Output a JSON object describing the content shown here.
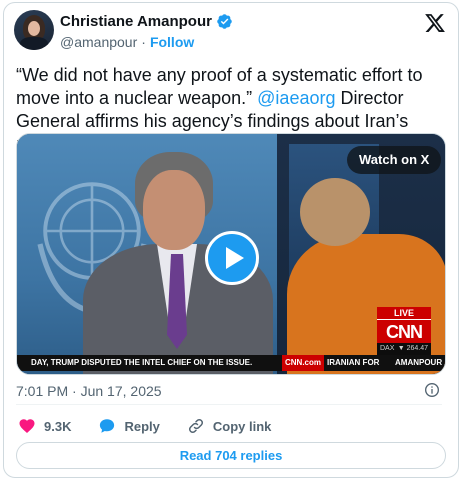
{
  "author": {
    "name": "Christiane Amanpour",
    "handle": "@amanpour",
    "separator": "·",
    "follow_label": "Follow",
    "verified_color": "#1d9bf0"
  },
  "tweet": {
    "text_before": "“We did not have any proof of a systematic effort to move into a nuclear weapon.”",
    "mention": "@iaeaorg",
    "text_after": "Director General affirms his agency’s findings about Iran’s nuclear program."
  },
  "media": {
    "watch_label": "Watch on X",
    "live_label": "LIVE",
    "network_logo": "CNN",
    "dax_label": "DAX",
    "dax_value": "▼ 264.47",
    "ticker_text": "DAY, TRUMP DISPUTED THE INTEL CHIEF ON THE ISSUE.",
    "ticker_site": "CNN.com",
    "ticker_text_2": "IRANIAN FOR",
    "ticker_show": "AMANPOUR",
    "play_icon": "play-icon"
  },
  "meta": {
    "time": "7:01 PM",
    "separator": "·",
    "date": "Jun 17, 2025"
  },
  "actions": {
    "likes": "9.3K",
    "reply_label": "Reply",
    "copy_label": "Copy link"
  },
  "read_replies_label": "Read 704 replies",
  "colors": {
    "accent": "#1d9bf0",
    "like_red": "#f91880",
    "text_secondary": "#536471",
    "cnn_red": "#cc0000"
  }
}
